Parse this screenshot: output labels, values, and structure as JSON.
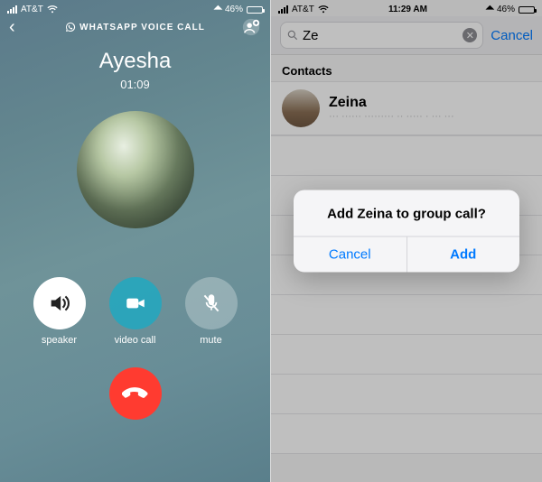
{
  "left": {
    "status": {
      "carrier": "AT&T",
      "battery_pct": "46%",
      "battery_fill": 46
    },
    "header_title": "WHATSAPP VOICE CALL",
    "caller_name": "Ayesha",
    "call_timer": "01:09",
    "controls": {
      "speaker": "speaker",
      "video": "video call",
      "mute": "mute"
    }
  },
  "right": {
    "status": {
      "carrier": "AT&T",
      "time": "11:29 AM",
      "battery_pct": "46%",
      "battery_fill": 46
    },
    "search": {
      "icon": "search-icon",
      "query": "Ze",
      "cancel": "Cancel"
    },
    "section_title": "Contacts",
    "contact": {
      "name": "Zeina",
      "subtitle": "··· ······ ········· ·· ····· · ··· ···"
    },
    "alert": {
      "message": "Add Zeina to group call?",
      "cancel": "Cancel",
      "confirm": "Add"
    }
  }
}
